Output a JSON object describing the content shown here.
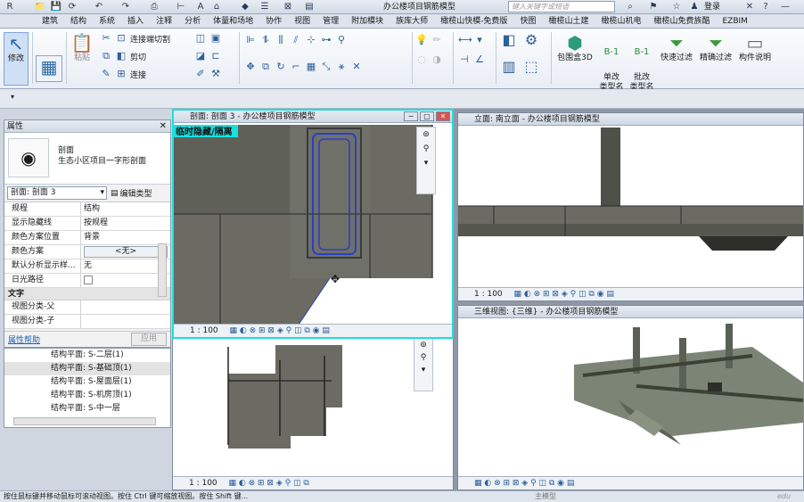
{
  "app": {
    "title": "办公楼项目钢筋模型",
    "search_placeholder": "键入关键字或短语",
    "login_label": "登录"
  },
  "ribbon_tabs": [
    "建筑",
    "结构",
    "系统",
    "插入",
    "注释",
    "分析",
    "体量和场地",
    "协作",
    "视图",
    "管理",
    "附加模块",
    "族库大师",
    "橄榄山快模-免费版",
    "快图",
    "橄榄山土建",
    "橄榄山机电",
    "橄榄山免费族酷",
    "EZBIM"
  ],
  "ribbon": {
    "modify_label": "修改",
    "paste_label": "粘贴",
    "join_cut_label": "连接端切割",
    "cut_label": "剪切",
    "connect_label": "连接",
    "bbox3d_label": "包围盒3D",
    "single_type_label": "单改\n类型名",
    "batch_type_label": "批改\n类型名",
    "quick_filter_label": "快速过滤",
    "precise_filter_label": "精确过滤",
    "component_desc_label": "构件说明"
  },
  "properties": {
    "panel_title": "属性",
    "type_name_line1": "剖面",
    "type_name_line2": "生态小区项目一字形剖面",
    "selector_value": "剖面: 剖面 3",
    "edit_type_label": "编辑类型",
    "rows": [
      {
        "name": "规程",
        "value": "结构"
      },
      {
        "name": "显示隐藏线",
        "value": "按规程"
      },
      {
        "name": "颜色方案位置",
        "value": "背景"
      },
      {
        "name": "颜色方案",
        "value": "<无>"
      },
      {
        "name": "默认分析显示样...",
        "value": "无"
      },
      {
        "name": "日光路径",
        "value": ""
      }
    ],
    "section_text": "文字",
    "text_rows": [
      {
        "name": "视图分类-父",
        "value": ""
      },
      {
        "name": "视图分类-子",
        "value": ""
      }
    ],
    "help_label": "属性帮助",
    "apply_label": "应用"
  },
  "browser": {
    "items": [
      "结构平面: S-二层(1)",
      "结构平面: S-基础顶(1)",
      "结构平面: S-屋面层(1)",
      "结构平面: S-机房顶(1)",
      "结构平面: S-中一层"
    ]
  },
  "views": {
    "section_title": "剖面: 剖面 3 - 办公楼项目钢筋模型",
    "section_banner": "临时隐藏/隔离",
    "section_scale": "1 : 100",
    "elevation_title": "立面: 南立面 - 办公楼项目钢筋模型",
    "elevation_scale": "1 : 100",
    "view3d_title": "三维视图: {三维} - 办公楼项目钢筋模型",
    "plan_scale": "1 : 100"
  },
  "status": {
    "text": "按住鼠标键并移动鼠标可滚动视图。按住 Ctrl 键可缩放视图。按住 Shift 键...",
    "main_model": "主模型",
    "watermark": "edu"
  },
  "colors": {
    "accent_cyan": "#19e0e0",
    "concrete": "#6b6b63",
    "concrete_dark": "#4e504a",
    "rebar_blue": "#2a3fc7",
    "model_3d": "#7c8475"
  }
}
